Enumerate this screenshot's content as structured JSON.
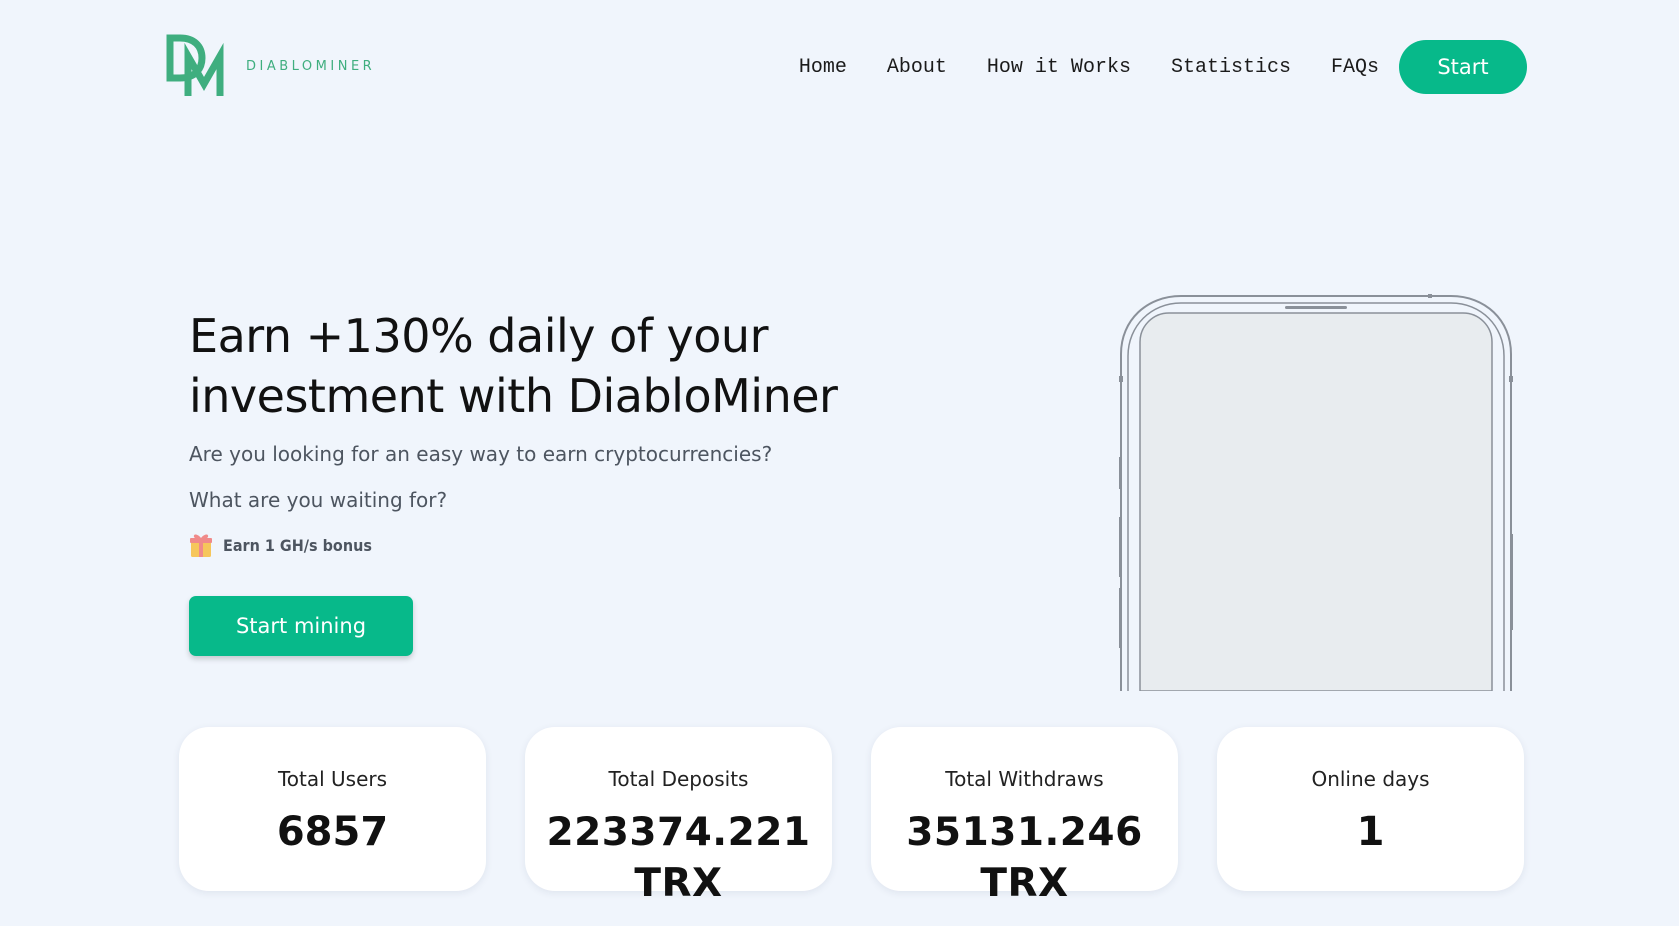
{
  "header": {
    "logo_text": "DIABLOMINER",
    "brand_color": "#3fae7f",
    "nav": [
      {
        "label": "Home"
      },
      {
        "label": "About"
      },
      {
        "label": "How it Works"
      },
      {
        "label": "Statistics"
      },
      {
        "label": "FAQs"
      }
    ],
    "start_label": "Start",
    "accent_color": "#07b98a"
  },
  "hero": {
    "title_line1": "Earn +130% daily of your",
    "title_line2": "investment with DiabloMiner",
    "text1": "Are you looking for an easy way to earn cryptocurrencies?",
    "text2": "What are you waiting for?",
    "bonus_icon": "gift-icon",
    "bonus_text": "Earn 1 GH/s bonus",
    "cta_label": "Start mining"
  },
  "phone": {
    "icon": "phone-mockup-icon"
  },
  "stats": [
    {
      "label": "Total Users",
      "value_line1": "6857",
      "value_line2": ""
    },
    {
      "label": "Total Deposits",
      "value_line1": "223374.221",
      "value_line2": "TRX"
    },
    {
      "label": "Total Withdraws",
      "value_line1": "35131.246",
      "value_line2": "TRX"
    },
    {
      "label": "Online days",
      "value_line1": "1",
      "value_line2": ""
    }
  ]
}
